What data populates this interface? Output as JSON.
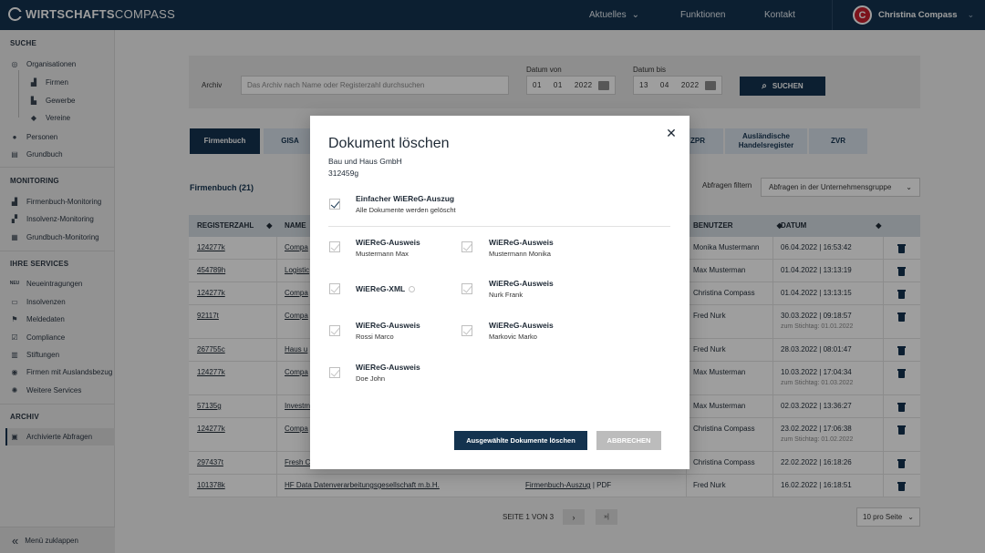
{
  "header": {
    "logo_bold": "WIRTSCHAFTS",
    "logo_light": "COMPASS",
    "nav": [
      "Aktuelles",
      "Funktionen",
      "Kontakt"
    ],
    "user_name": "Christina Compass",
    "avatar_letter": "C"
  },
  "sidebar": {
    "suche": "SUCHE",
    "organisationen": "Organisationen",
    "firmen": "Firmen",
    "gewerbe": "Gewerbe",
    "vereine": "Vereine",
    "personen": "Personen",
    "grundbuch": "Grundbuch",
    "monitoring": "MONITORING",
    "firmenbuch_monitoring": "Firmenbuch-Monitoring",
    "insolvenz_monitoring": "Insolvenz-Monitoring",
    "grundbuch_monitoring": "Grundbuch-Monitoring",
    "services": "IHRE SERVICES",
    "neueintragungen_icon": "NEU",
    "neueintragungen": "Neueintragungen",
    "insolvenzen": "Insolvenzen",
    "meldedaten": "Meldedaten",
    "compliance": "Compliance",
    "stiftungen": "Stiftungen",
    "auslandsbezug": "Firmen mit Auslandsbezug",
    "weitere": "Weitere Services",
    "archiv": "ARCHIV",
    "archivierte": "Archivierte Abfragen",
    "collapse": "Menü zuklappen"
  },
  "search": {
    "label": "Archiv",
    "placeholder": "Das Archiv nach Name oder Registerzahl durchsuchen",
    "from_label": "Datum von",
    "from": [
      "01",
      "01",
      "2022"
    ],
    "to_label": "Datum bis",
    "to": [
      "13",
      "04",
      "2022"
    ],
    "button": "SUCHEN"
  },
  "tabs": [
    "Firmenbuch",
    "GISA",
    "ZPR",
    "Ausländische Handelsregister",
    "ZVR"
  ],
  "list": {
    "count": "Firmenbuch (21)",
    "filter_label": "Abfragen filtern",
    "filter_value": "Abfragen in der Unternehmensgruppe"
  },
  "table": {
    "headers": [
      "REGISTERZAHL",
      "NAME",
      "BENUTZER",
      "DATUM"
    ],
    "rows": [
      {
        "reg": "124277k",
        "name": "Compa",
        "prod": "",
        "user": "Monika Mustermann",
        "date": "06.04.2022 | 16:53:42",
        "stichtag": ""
      },
      {
        "reg": "454789h",
        "name": "Logistic",
        "prod": "",
        "user": "Max Musterman",
        "date": "01.04.2022 | 13:13:19",
        "stichtag": ""
      },
      {
        "reg": "124277k",
        "name": "Compa",
        "prod": "",
        "user": "Christina Compass",
        "date": "01.04.2022 | 13:13:15",
        "stichtag": ""
      },
      {
        "reg": "92117t",
        "name": "Compa",
        "prod": "",
        "user": "Fred Nurk",
        "date": "30.03.2022 | 09:18:57",
        "stichtag": "zum Stichtag: 01.01.2022"
      },
      {
        "reg": "267755c",
        "name": "Haus u",
        "prod": "",
        "user": "Fred Nurk",
        "date": "28.03.2022 | 08:01:47",
        "stichtag": ""
      },
      {
        "reg": "124277k",
        "name": "Compa",
        "prod": "",
        "user": "Max Musterman",
        "date": "10.03.2022 | 17:04:34",
        "stichtag": "zum Stichtag: 01.03.2022"
      },
      {
        "reg": "57135g",
        "name": "Investm",
        "prod": "",
        "user": "Max Musterman",
        "date": "02.03.2022 | 13:36:27",
        "stichtag": ""
      },
      {
        "reg": "124277k",
        "name": "Compa",
        "prod": "",
        "user": "Christina Compass",
        "date": "23.02.2022 | 17:06:38",
        "stichtag": "zum Stichtag: 01.02.2022"
      },
      {
        "reg": "297437t",
        "name": "Fresh C",
        "prod": "",
        "user": "Christina Compass",
        "date": "22.02.2022 | 16:18:26",
        "stichtag": ""
      },
      {
        "reg": "101378k",
        "name": "HF Data Datenverarbeitungsgesellschaft m.b.H.",
        "prod": "Firmenbuch-Auszug",
        "prod_suffix": " | PDF",
        "user": "Fred Nurk",
        "date": "16.02.2022 | 16:18:51",
        "stichtag": ""
      }
    ]
  },
  "pagination": {
    "info": "SEITE 1 VON 3",
    "next": "›",
    "last": "»|",
    "per_page": "10 pro Seite"
  },
  "modal": {
    "title": "Dokument löschen",
    "company": "Bau und Haus GmbH",
    "regnr": "312459g",
    "main_option": {
      "title": "Einfacher WiEReG-Auszug",
      "sub": "Alle Dokumente werden gelöscht"
    },
    "options": [
      {
        "title": "WiEReG-Ausweis",
        "sub": "Mustermann Max"
      },
      {
        "title": "WiEReG-Ausweis",
        "sub": "Mustermann Monika"
      },
      {
        "title": "WiEReG-XML",
        "sub": ""
      },
      {
        "title": "WiEReG-Ausweis",
        "sub": "Nurk Frank"
      },
      {
        "title": "WiEReG-Ausweis",
        "sub": "Rossi Marco"
      },
      {
        "title": "WiEReG-Ausweis",
        "sub": "Markovic Marko"
      },
      {
        "title": "WiEReG-Ausweis",
        "sub": "Doe John"
      }
    ],
    "delete_button": "Ausgewählte Dokumente löschen",
    "cancel_button": "ABBRECHEN",
    "close": "✕"
  }
}
